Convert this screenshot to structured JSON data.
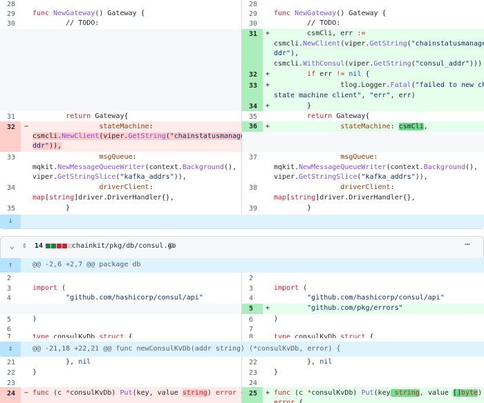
{
  "diff1": {
    "lines": [
      {
        "ln": "28",
        "rn": "28"
      },
      {
        "ln": "29",
        "rn": "29",
        "ltext": "func NewGateway() Gateway {",
        "rtext": "func NewGateway() Gateway {"
      },
      {
        "ln": "30",
        "rn": "30",
        "ltext": "        // TODO:",
        "rtext": "        // TODO:"
      }
    ],
    "added": [
      {
        "rn": "31",
        "text": "        csmCli, err :="
      },
      {
        "rn": "",
        "text": "csmcli.NewClient(viper.GetString(\"chainstatusmanager_a"
      },
      {
        "rn": "",
        "text": "ddr\"),"
      },
      {
        "rn": "",
        "text": "csmcli.WithConsul(viper.GetString(\"consul_addr\")))"
      },
      {
        "rn": "32",
        "text": "        if err != nil {"
      },
      {
        "rn": "33",
        "text": "                tlog.Logger.Fatal(\"failed to new chain"
      },
      {
        "rn": "",
        "text": "state machine client\", \"err\", err)"
      },
      {
        "rn": "34",
        "text": "        }"
      }
    ],
    "row31": {
      "ln": "31",
      "rn": "35",
      "ltext": "        return Gateway{",
      "rtext": "        return Gateway{"
    },
    "row32": {
      "ln": "32",
      "rn": "36",
      "l1": "                stateMachine:",
      "l2a": "csmcli.NewClient(viper.GetString(\"chainstatusmanager_a",
      "l2b": "ddr\")),",
      "r1": "                stateMachine: csmCli,"
    },
    "row33": {
      "ln": "33",
      "rn": "37",
      "t1": "                msgQueue:",
      "t2": "mqkit.NewMessageQueueWriter(context.Background(),",
      "t3": "viper.GetStringSlice(\"kafka_addrs\")),"
    },
    "row34": {
      "ln": "34",
      "rn": "38",
      "t1": "                driverClient:",
      "t2": "map[string]driver.DriverHandler{},"
    },
    "row35": {
      "ln": "35",
      "rn": "39",
      "t1": "        }"
    }
  },
  "file2": {
    "changes": "14",
    "path": "chainkit/pkg/db/consul.go",
    "hunk1": "@@ -2,6 +2,7 @@ package db",
    "hunk2": "@@ -21,18 +22,21 @@ func newConsulKvDb(addr string) (*consulKvDb, error) {",
    "imp": "import (",
    "api": "        \"github.com/hashicorp/consul/api\"",
    "errors": "        \"github.com/pkg/errors\"",
    "close": ")",
    "nil": "        }, nil",
    "brace": "}",
    "put_l": "func (c *consulKvDb) Put(key, value string) error {",
    "put_r": "func (c *consulKvDb) Put(key string, value []byte)",
    "put_r2": "error {",
    "partial": "type consulKvDb struct {"
  },
  "colors": {
    "del": "#ffebe9",
    "add": "#e6ffec",
    "hunk": "#ddf4ff"
  }
}
